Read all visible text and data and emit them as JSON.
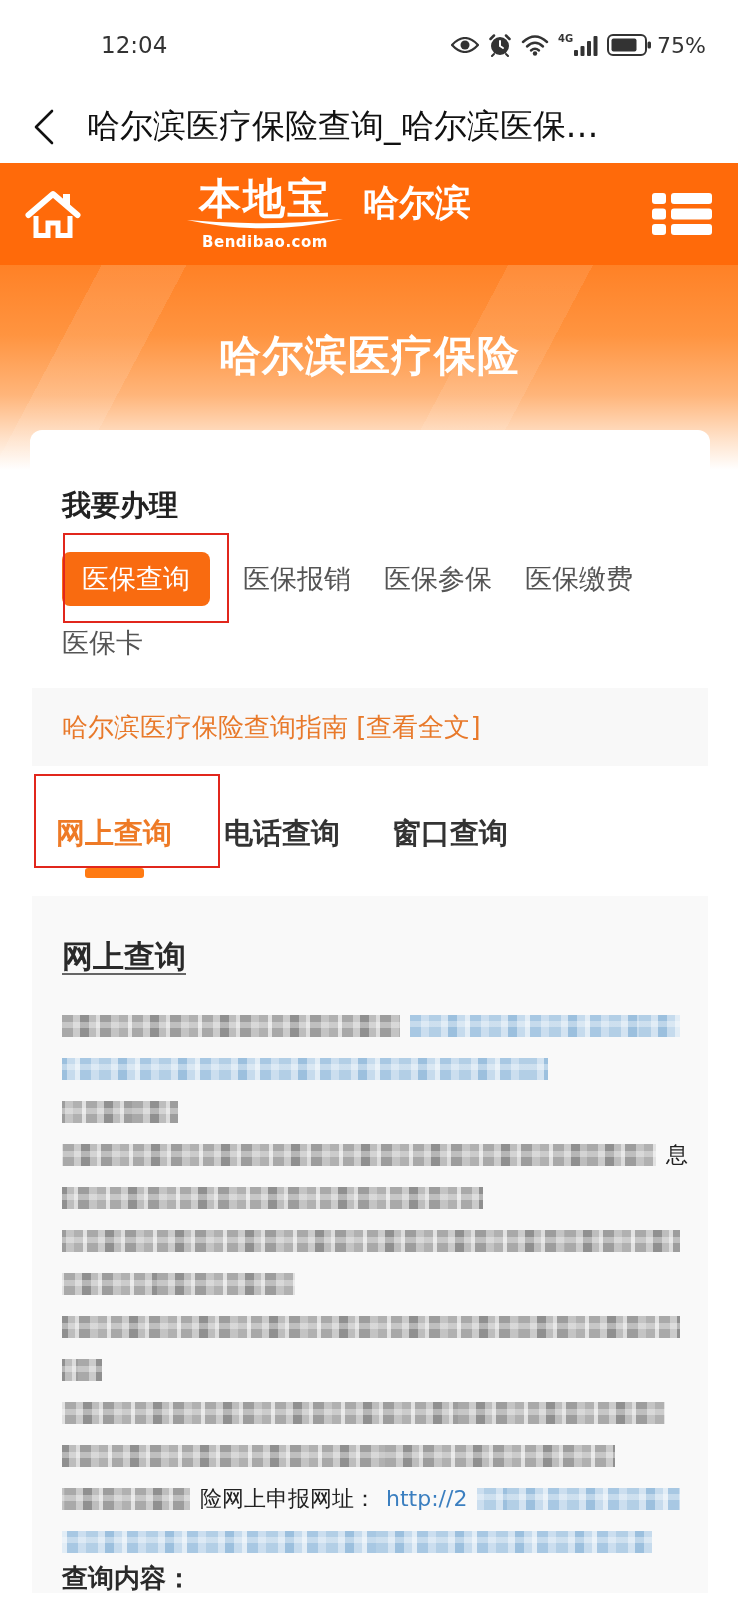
{
  "status_bar": {
    "time": "12:04",
    "network": "4G",
    "battery": "75%"
  },
  "nav_bar": {
    "title": "哈尔滨医疗保险查询_哈尔滨医保…"
  },
  "site_header": {
    "logo_text": "本地宝",
    "logo_domain": "Bendibao.com",
    "city": "哈尔滨"
  },
  "banner": {
    "title": "哈尔滨医疗保险"
  },
  "service_card": {
    "heading": "我要办理",
    "options": [
      {
        "label": "医保查询",
        "selected": true,
        "highlighted": true
      },
      {
        "label": "医保报销",
        "selected": false,
        "highlighted": false
      },
      {
        "label": "医保参保",
        "selected": false,
        "highlighted": false
      },
      {
        "label": "医保缴费",
        "selected": false,
        "highlighted": false
      },
      {
        "label": "医保卡",
        "selected": false,
        "highlighted": false
      }
    ],
    "guide_link": "哈尔滨医疗保险查询指南 [查看全文]"
  },
  "method_tabs": [
    {
      "label": "网上查询",
      "selected": true,
      "highlighted": true
    },
    {
      "label": "电话查询",
      "selected": false,
      "highlighted": false
    },
    {
      "label": "窗口查询",
      "selected": false,
      "highlighted": false
    }
  ],
  "article": {
    "heading": "网上查询",
    "lines": [
      {
        "segments": [
          {
            "kind": "blur"
          },
          {
            "kind": "blur_link"
          }
        ]
      },
      {
        "segments": [
          {
            "kind": "blur_link"
          }
        ]
      },
      {
        "segments": [
          {
            "kind": "blur"
          }
        ]
      },
      {
        "segments": [
          {
            "kind": "blur"
          },
          {
            "kind": "text",
            "text": "息"
          }
        ]
      },
      {
        "segments": [
          {
            "kind": "blur"
          }
        ]
      },
      {
        "segments": [
          {
            "kind": "blur"
          }
        ]
      },
      {
        "segments": [
          {
            "kind": "blur"
          }
        ]
      },
      {
        "segments": [
          {
            "kind": "blur"
          }
        ]
      },
      {
        "segments": [
          {
            "kind": "blur"
          }
        ]
      },
      {
        "segments": [
          {
            "kind": "blur"
          }
        ]
      },
      {
        "segments": [
          {
            "kind": "blur"
          }
        ]
      },
      {
        "segments": [
          {
            "kind": "blur"
          },
          {
            "kind": "text",
            "text": "险网上申报网址："
          },
          {
            "kind": "link",
            "text": "http://2"
          },
          {
            "kind": "blur_link"
          }
        ]
      },
      {
        "segments": [
          {
            "kind": "blur_link"
          }
        ]
      }
    ],
    "subheading": "查询内容："
  }
}
